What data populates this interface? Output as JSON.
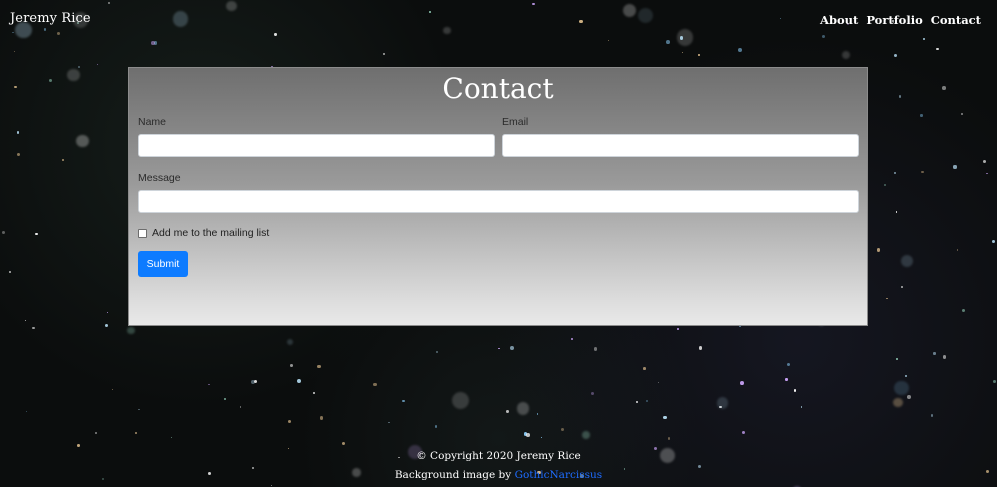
{
  "navbar": {
    "brand": "Jeremy Rice",
    "links": [
      "About",
      "Portfolio",
      "Contact"
    ]
  },
  "contact": {
    "title": "Contact",
    "name_label": "Name",
    "email_label": "Email",
    "message_label": "Message",
    "name_value": "",
    "email_value": "",
    "message_value": "",
    "mailing_list_label": "Add me to the mailing list",
    "mailing_list_checked": false,
    "submit_label": "Submit"
  },
  "footer": {
    "copyright": "© Copyright 2020 Jeremy Rice",
    "bg_credit_prefix": "Background image by ",
    "bg_credit_link": "GothicNarcissus"
  },
  "colors": {
    "accent": "#0d7bff",
    "link": "#1e6cff",
    "background": "#0b0d0d"
  },
  "icons": {
    "checkbox": "checkbox-unchecked-icon"
  }
}
